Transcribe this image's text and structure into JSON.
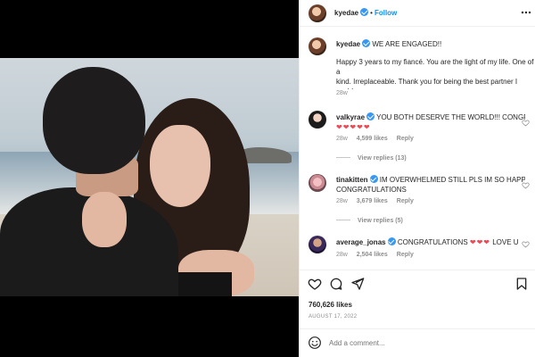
{
  "post": {
    "username": "kyedae",
    "follow_label": "Follow",
    "separator": "•",
    "title": "WE ARE ENGAGED!!",
    "caption": "Happy 3 years to my fiancé. You are the light of my life. One of a\nkind. Irreplaceable. Thank you for being the best partner I could\nhave ever hoped for.",
    "caption_age": "28w",
    "likes": "760,626 likes",
    "date": "AUGUST 17, 2022",
    "add_comment_placeholder": "Add a comment..."
  },
  "comments": [
    {
      "username": "valkyrae",
      "text": "YOU BOTH DESERVE THE WORLD!!! CONGRATS!!!",
      "hearts": "❤❤❤❤❤",
      "age": "28w",
      "likes": "4,599 likes",
      "reply_label": "Reply",
      "view_replies": "View replies (13)"
    },
    {
      "username": "tinakitten",
      "text_line1": "IM OVERWHELMED STILL PLS IM SO HAPPY",
      "text_line2": "CONGRATULATIONS",
      "age": "28w",
      "likes": "3,679 likes",
      "reply_label": "Reply",
      "view_replies": "View replies (5)"
    },
    {
      "username": "average_jonas",
      "text": "CONGRATULATIONS",
      "hearts": "❤❤❤",
      "text_after": "LOVE U",
      "age": "28w",
      "likes": "2,504 likes",
      "reply_label": "Reply"
    }
  ],
  "icons": {
    "like": "heart-icon",
    "comment": "comment-icon",
    "share": "share-icon",
    "emoji": "emoji-icon"
  },
  "colors": {
    "accent": "#0095f6",
    "verified": "#3897f0",
    "heart": "#ed4956",
    "muted": "#8e8e8e"
  }
}
